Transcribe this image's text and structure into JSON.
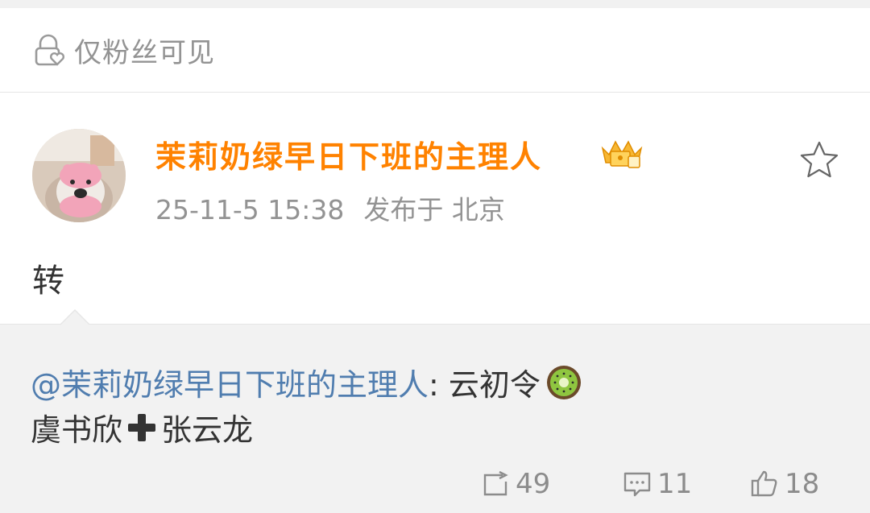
{
  "visibility": {
    "label": "仅粉丝可见",
    "icon": "lock-heart-icon"
  },
  "post": {
    "author": "茉莉奶绿早日下班的主理人",
    "author_color": "#ff8200",
    "badge_icon": "crown-badge-icon",
    "date": "25-11-5 15:38",
    "location": "发布于 北京",
    "text": "转",
    "favorite_icon": "star-icon"
  },
  "repost": {
    "mention": "@茉莉奶绿早日下班的主理人",
    "colon_text": ": 云初令",
    "emoji": "kiwi-emoji",
    "line2_a": "虞书欣",
    "line2_icon": "plus-emoji",
    "line2_b": "张云龙",
    "mention_color": "#507daf"
  },
  "actions": {
    "forward_count": "49",
    "comment_count": "11",
    "like_count": "18"
  }
}
